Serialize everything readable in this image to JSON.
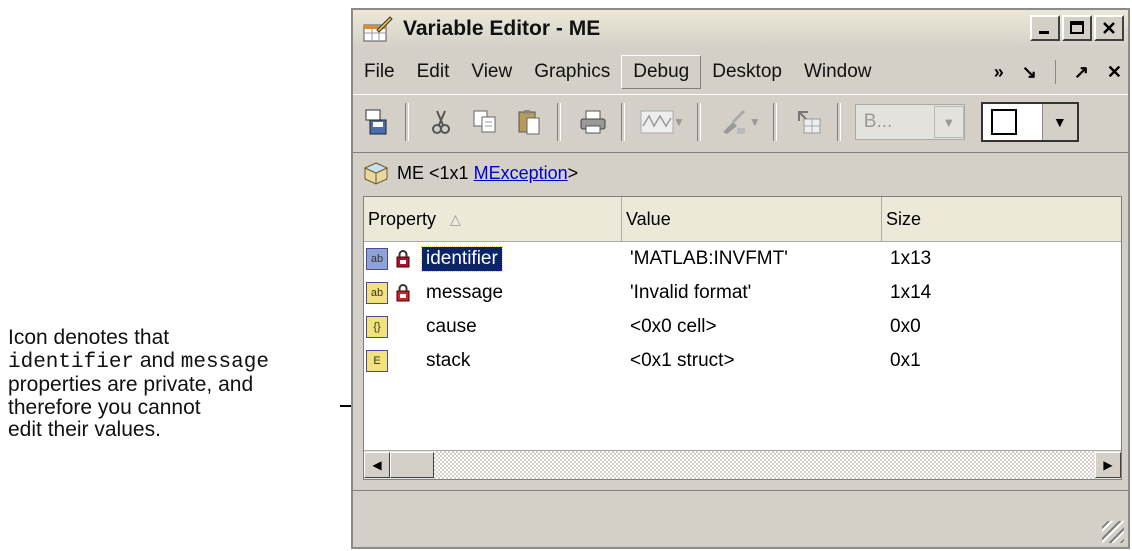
{
  "callout": {
    "line1": "Icon denotes that",
    "line2_code1": "identifier",
    "line2_and": " and ",
    "line2_code2": "message",
    "line3": "properties are private, and",
    "line4": "therefore you cannot",
    "line5": "edit their values."
  },
  "window": {
    "title": "Variable Editor - ME",
    "minimize_icon": "minimize-icon",
    "maximize_icon": "maximize-icon",
    "close_icon": "close-icon"
  },
  "menu": {
    "items": [
      "File",
      "Edit",
      "View",
      "Graphics",
      "Debug",
      "Desktop",
      "Window"
    ],
    "active": "Debug",
    "overflow": "»",
    "undock": "↘",
    "dock": "↗",
    "close": "✕"
  },
  "toolbar": {
    "combo_text": "B...",
    "icons": [
      "import-data-icon",
      "cut-icon",
      "copy-icon",
      "paste-icon",
      "print-icon",
      "plot-icon",
      "brush-icon",
      "parent-icon",
      "grid-icon"
    ]
  },
  "variable": {
    "name": "ME",
    "size_prefix": "<1x1",
    "class_name": "MException",
    "suffix": ">"
  },
  "grid": {
    "headers": {
      "property": "Property",
      "value": "Value",
      "size": "Size"
    },
    "rows": [
      {
        "type_icon": "ab",
        "private": true,
        "name": "identifier",
        "value": "'MATLAB:INVFMT'",
        "size": "1x13",
        "selected": true
      },
      {
        "type_icon": "ab",
        "private": true,
        "name": "message",
        "value": "'Invalid format'",
        "size": "1x14",
        "selected": false
      },
      {
        "type_icon": "{}",
        "private": false,
        "name": "cause",
        "value": "<0x0 cell>",
        "size": "0x0",
        "selected": false
      },
      {
        "type_icon": "E",
        "private": false,
        "name": "stack",
        "value": "<0x1 struct>",
        "size": "0x1",
        "selected": false
      }
    ]
  },
  "colors": {
    "selection": "#0a246a",
    "link": "#0000cc",
    "lock": "#b01030",
    "chrome": "#d4d0c8"
  }
}
